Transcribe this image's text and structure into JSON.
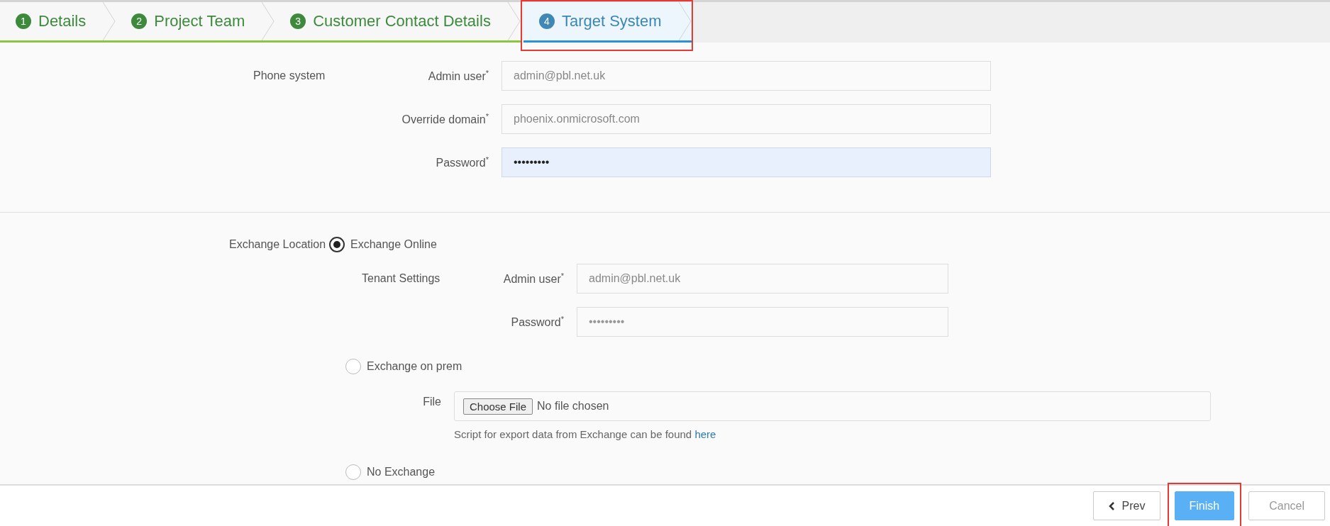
{
  "tabs": [
    {
      "number": "1",
      "label": "Details",
      "selected": false,
      "completed": true,
      "highlighted": false
    },
    {
      "number": "2",
      "label": "Project Team",
      "selected": false,
      "completed": true,
      "highlighted": false
    },
    {
      "number": "3",
      "label": "Customer Contact Details",
      "selected": false,
      "completed": true,
      "highlighted": false
    },
    {
      "number": "4",
      "label": "Target System",
      "selected": true,
      "completed": false,
      "highlighted": true
    }
  ],
  "phone_system": {
    "label": "Phone system",
    "fields": [
      {
        "label": "Admin user$^{*}$",
        "value": "admin@pbl.net.uk",
        "focused": false,
        "kind": "text"
      },
      {
        "label": "Override domain$^{*}$",
        "value": "phoenix.onmicrosoft.com",
        "focused": false,
        "kind": "text"
      },
      {
        "label": "Password$^{*}$",
        "value": "•••••••••",
        "focused": true,
        "kind": "password"
      }
    ]
  },
  "exchange": {
    "label": "Exchange Location",
    "options": [
      {
        "label": "Exchange Online",
        "selected": true,
        "kind": "tenant",
        "tenant_settings": {
          "label": "Tenant Settings",
          "fields": [
            {
              "label": "Admin user$^{*}$",
              "value": "admin@pbl.net.uk",
              "focused": false,
              "kind": "text"
            },
            {
              "label": "Password$^{*}$",
              "value": "•••••••••",
              "focused": false,
              "kind": "password"
            }
          ]
        }
      },
      {
        "label": "Exchange on prem",
        "selected": false,
        "kind": "file",
        "file": {
          "label": "File",
          "button": "Choose File",
          "status": "No file chosen",
          "hint": "Script for export data from Exchange can be found",
          "link": "here"
        }
      },
      {
        "label": "No Exchange",
        "selected": false,
        "kind": "none"
      }
    ]
  },
  "footer_buttons": [
    {
      "label": "Prev",
      "kind": "prev",
      "highlighted": false
    },
    {
      "label": "Finish",
      "kind": "primary",
      "highlighted": true
    },
    {
      "label": "Cancel",
      "kind": "secondary",
      "highlighted": false
    }
  ]
}
